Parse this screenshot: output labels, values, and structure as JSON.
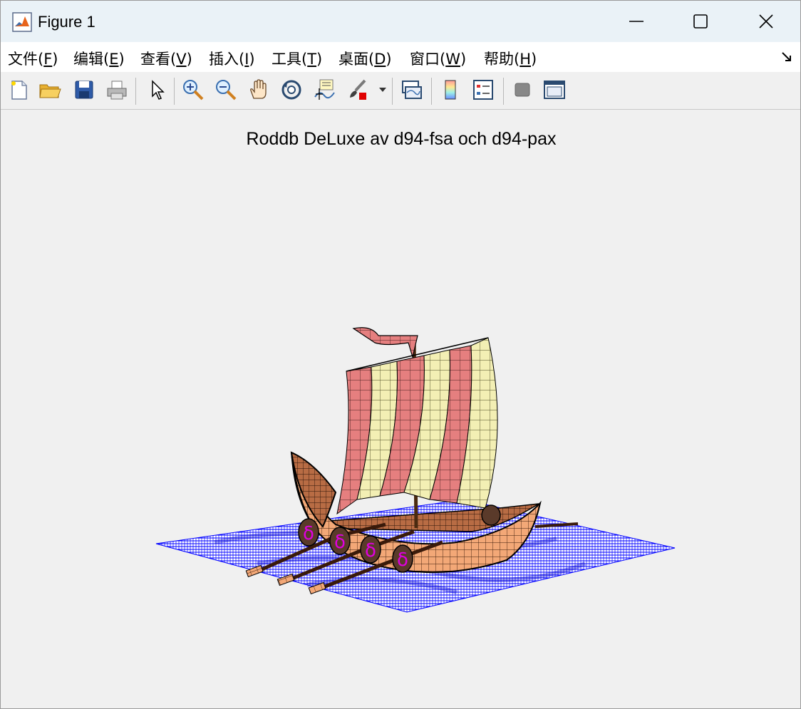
{
  "window": {
    "title": "Figure 1"
  },
  "menu": {
    "items": [
      {
        "name": "menu-file",
        "text": "文件(",
        "key": "F",
        "close": ")"
      },
      {
        "name": "menu-edit",
        "text": "编辑(",
        "key": "E",
        "close": ")"
      },
      {
        "name": "menu-view",
        "text": "查看(",
        "key": "V",
        "close": ")"
      },
      {
        "name": "menu-insert",
        "text": "插入(",
        "key": "I",
        "close": ")"
      },
      {
        "name": "menu-tools",
        "text": "工具(",
        "key": "T",
        "close": ")"
      },
      {
        "name": "menu-desktop",
        "text": "桌面(",
        "key": "D",
        "close": ")"
      },
      {
        "name": "menu-window",
        "text": "窗口(",
        "key": "W",
        "close": ")"
      },
      {
        "name": "menu-help",
        "text": "帮助(",
        "key": "H",
        "close": ")"
      }
    ]
  },
  "toolbar": {
    "icons": [
      "new-figure-icon",
      "open-file-icon",
      "save-icon",
      "print-icon",
      "select-arrow-icon",
      "zoom-in-icon",
      "zoom-out-icon",
      "pan-hand-icon",
      "rotate-3d-icon",
      "data-cursor-icon",
      "brush-icon",
      "link-plot-icon",
      "colorbar-icon",
      "legend-icon",
      "hide-plot-tools-icon",
      "show-plot-tools-icon"
    ]
  },
  "figure": {
    "title": "Roddb DeLuxe av d94-fsa och d94-pax",
    "shield_glyph": "δ"
  },
  "colors": {
    "water": "#0000ff",
    "hull": "#f0a070",
    "sail_red": "#e87878",
    "sail_cream": "#f0eab0",
    "shield": "#5a3a2a",
    "shield_glyph": "#e000e0"
  }
}
